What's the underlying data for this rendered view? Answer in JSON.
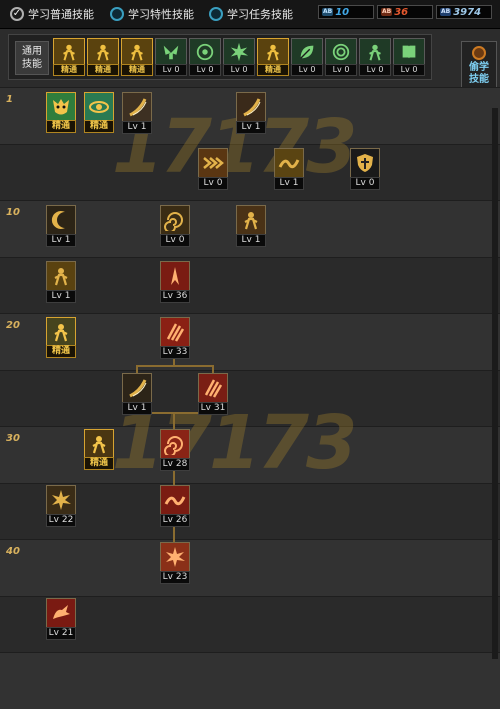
{
  "options": [
    {
      "label": "学习普通技能",
      "selected": true
    },
    {
      "label": "学习特性技能",
      "selected": false
    },
    {
      "label": "学习任务技能",
      "selected": false
    }
  ],
  "points": [
    {
      "tag": "AB",
      "value": "10",
      "color": "#41a8e6"
    },
    {
      "tag": "AB",
      "value": "36",
      "color": "#e5582e"
    },
    {
      "tag": "AB",
      "value": "3974",
      "color": "#9ec8e8"
    }
  ],
  "quick_bar": {
    "label": "通用\n技能",
    "slots": [
      {
        "icon": "figure-icon",
        "caption": "精通",
        "elite": true
      },
      {
        "icon": "rope-icon",
        "caption": "精通",
        "elite": true
      },
      {
        "icon": "runner-icon",
        "caption": "精通",
        "elite": true
      },
      {
        "icon": "wings-icon",
        "caption": "Lv 0",
        "elite": false
      },
      {
        "icon": "target-icon",
        "caption": "Lv 0",
        "elite": false
      },
      {
        "icon": "star-burst-icon",
        "caption": "Lv 0",
        "elite": false
      },
      {
        "icon": "seated-figure-icon",
        "caption": "精通",
        "elite": true
      },
      {
        "icon": "leaf-icon",
        "caption": "Lv 0",
        "elite": false
      },
      {
        "icon": "eye-ring-icon",
        "caption": "Lv 0",
        "elite": false
      },
      {
        "icon": "buff-figure-icon",
        "caption": "Lv 0",
        "elite": false
      },
      {
        "icon": "book-icon",
        "caption": "Lv 0",
        "elite": false
      }
    ]
  },
  "learn_button": {
    "label": "偷学\n技能"
  },
  "watermark": "17173",
  "rows": [
    {
      "level": "1"
    },
    {
      "level": ""
    },
    {
      "level": "10"
    },
    {
      "level": ""
    },
    {
      "level": "20"
    },
    {
      "level": ""
    },
    {
      "level": "30"
    },
    {
      "level": ""
    },
    {
      "level": "40"
    },
    {
      "level": ""
    },
    {
      "level": ""
    }
  ],
  "skills": [
    {
      "name": "mo-skill",
      "icon": "demon-mask-icon",
      "caption": "精通",
      "elite": true,
      "color": "#2f7d3c"
    },
    {
      "name": "eye-skill",
      "icon": "eye-icon",
      "caption": "精通",
      "elite": true,
      "color": "#2a7a52"
    },
    {
      "name": "slash-skill-1",
      "icon": "slash-icon",
      "caption": "Lv 1",
      "elite": false,
      "color": "#3d3022"
    },
    {
      "name": "slash-skill-2",
      "icon": "slash-icon",
      "caption": "Lv 1",
      "elite": false,
      "color": "#3a2a1a"
    },
    {
      "name": "dash-skill",
      "icon": "chevrons-icon",
      "caption": "Lv 0",
      "elite": false,
      "color": "#5a3612"
    },
    {
      "name": "sweep-skill",
      "icon": "sweep-icon",
      "caption": "Lv 1",
      "elite": false,
      "color": "#5a4412"
    },
    {
      "name": "shield-skill",
      "icon": "shield-icon",
      "caption": "Lv 0",
      "elite": false,
      "color": "#1a1a1a"
    },
    {
      "name": "crescent-skill",
      "icon": "crescent-icon",
      "caption": "Lv 1",
      "elite": false,
      "color": "#2c2416"
    },
    {
      "name": "vortex-skill",
      "icon": "vortex-icon",
      "caption": "Lv 0",
      "elite": false,
      "color": "#3a2c14"
    },
    {
      "name": "kick-skill",
      "icon": "kick-icon",
      "caption": "Lv 1",
      "elite": false,
      "color": "#4a3216"
    },
    {
      "name": "flurry-skill",
      "icon": "flurry-icon",
      "caption": "Lv 1",
      "elite": false,
      "color": "#5a4210"
    },
    {
      "name": "blood-spire-skill",
      "icon": "spire-icon",
      "caption": "Lv 36",
      "elite": false,
      "color": "#7a1c12"
    },
    {
      "name": "rage-figure-skill",
      "icon": "rage-figure-icon",
      "caption": "精通",
      "elite": true,
      "color": "#46441e"
    },
    {
      "name": "blood-slash-skill",
      "icon": "blood-slash-icon",
      "caption": "Lv 33",
      "elite": false,
      "color": "#8a2014"
    },
    {
      "name": "dark-slash-skill",
      "icon": "slash-icon",
      "caption": "Lv 1",
      "elite": false,
      "color": "#2c2418"
    },
    {
      "name": "red-claw-skill",
      "icon": "claw-icon",
      "caption": "Lv 31",
      "elite": false,
      "color": "#7a1e14"
    },
    {
      "name": "grab-skill",
      "icon": "grab-icon",
      "caption": "精通",
      "elite": true,
      "color": "#4a3612"
    },
    {
      "name": "blood-whirl-skill",
      "icon": "whirl-icon",
      "caption": "Lv 28",
      "elite": false,
      "color": "#8a2416"
    },
    {
      "name": "burst-skill",
      "icon": "burst-icon",
      "caption": "Lv 22",
      "elite": false,
      "color": "#3a2c16"
    },
    {
      "name": "blood-wave-skill",
      "icon": "wave-icon",
      "caption": "Lv 26",
      "elite": false,
      "color": "#7a1c12"
    },
    {
      "name": "blood-blast-skill",
      "icon": "blast-icon",
      "caption": "Lv 23",
      "elite": false,
      "color": "#8a3018"
    },
    {
      "name": "blood-dragon-skill",
      "icon": "dragon-icon",
      "caption": "Lv 21",
      "elite": false,
      "color": "#7a1a12"
    }
  ]
}
